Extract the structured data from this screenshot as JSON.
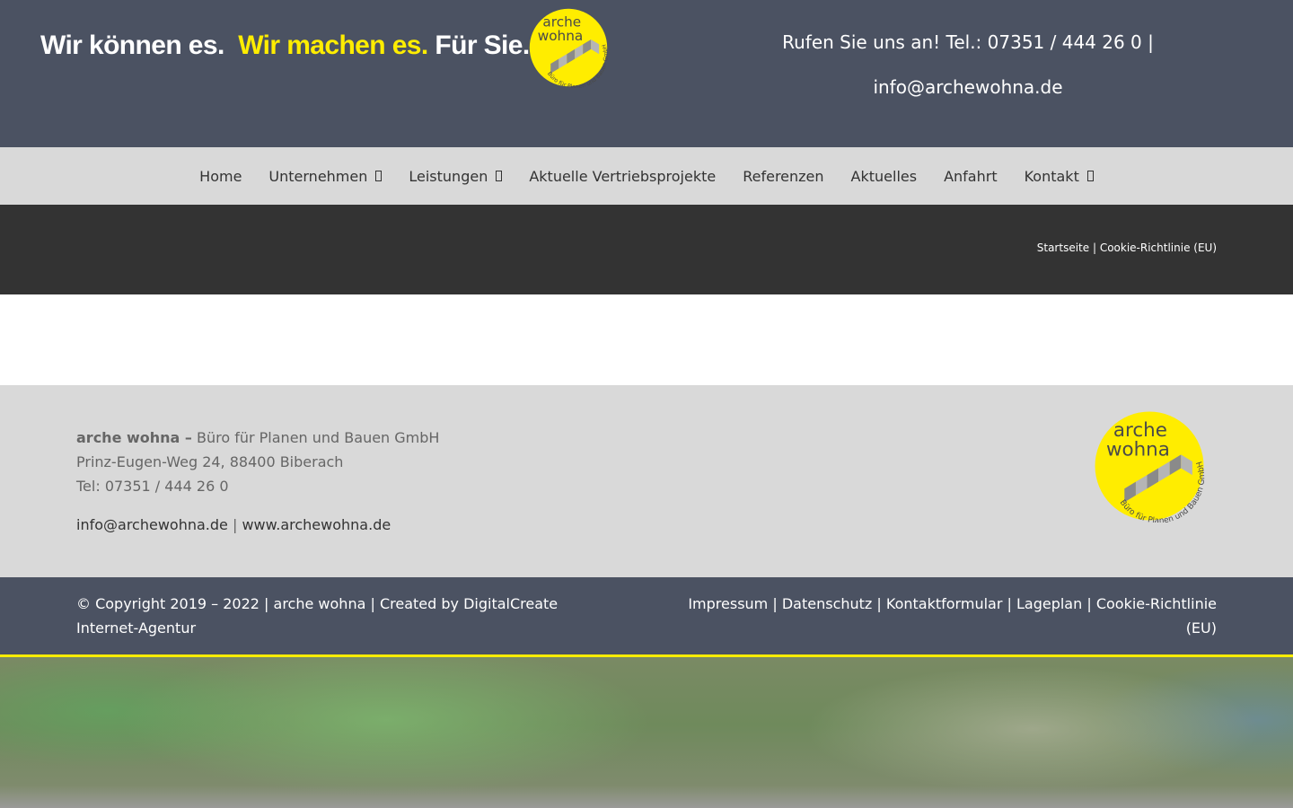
{
  "header": {
    "slogan_part1": "Wir können es.",
    "slogan_part2": "Wir machen es.",
    "slogan_part3": "Für Sie.",
    "contact_line1": "Rufen Sie uns an! Tel.: 07351 / 444 26 0 |",
    "contact_line2": "info@archewohna.de",
    "logo": {
      "line1": "arche",
      "line2": "wohna",
      "circle_text": "Büro für Planen und Bauen GmbH",
      "icon": "stairs-logo-icon"
    }
  },
  "nav": {
    "items": [
      {
        "label": "Home",
        "has_submenu": false
      },
      {
        "label": "Unternehmen",
        "has_submenu": true
      },
      {
        "label": "Leistungen",
        "has_submenu": true
      },
      {
        "label": "Aktuelle Vertriebsprojekte",
        "has_submenu": false
      },
      {
        "label": "Referenzen",
        "has_submenu": false
      },
      {
        "label": "Aktuelles",
        "has_submenu": false
      },
      {
        "label": "Anfahrt",
        "has_submenu": false
      },
      {
        "label": "Kontakt",
        "has_submenu": true
      }
    ]
  },
  "breadcrumb": {
    "home": "Startseite",
    "separator": "|",
    "current": "Cookie-Richtlinie (EU)"
  },
  "footer": {
    "company_bold": "arche wohna –",
    "company_rest": "Büro für Planen und Bauen GmbH",
    "address": "Prinz-Eugen-Weg 24, 88400 Biberach",
    "phone": "Tel: 07351 / 444 26 0",
    "email": "info@archewohna.de",
    "link_separator": "|",
    "website": "www.archewohna.de"
  },
  "copyright": {
    "text": "© Copyright 2019 – 2022 | arche wohna | Created by",
    "agency": "DigitalCreate Internet-Agentur",
    "links": [
      "Impressum",
      "Datenschutz",
      "Kontaktformular",
      "Lageplan",
      "Cookie-Richtlinie (EU)"
    ],
    "separator": "|"
  },
  "colors": {
    "header_bg": "#4b5262",
    "accent_yellow": "#ffed00",
    "nav_bg": "#d9d9d9",
    "titlebar_bg": "#333333"
  }
}
